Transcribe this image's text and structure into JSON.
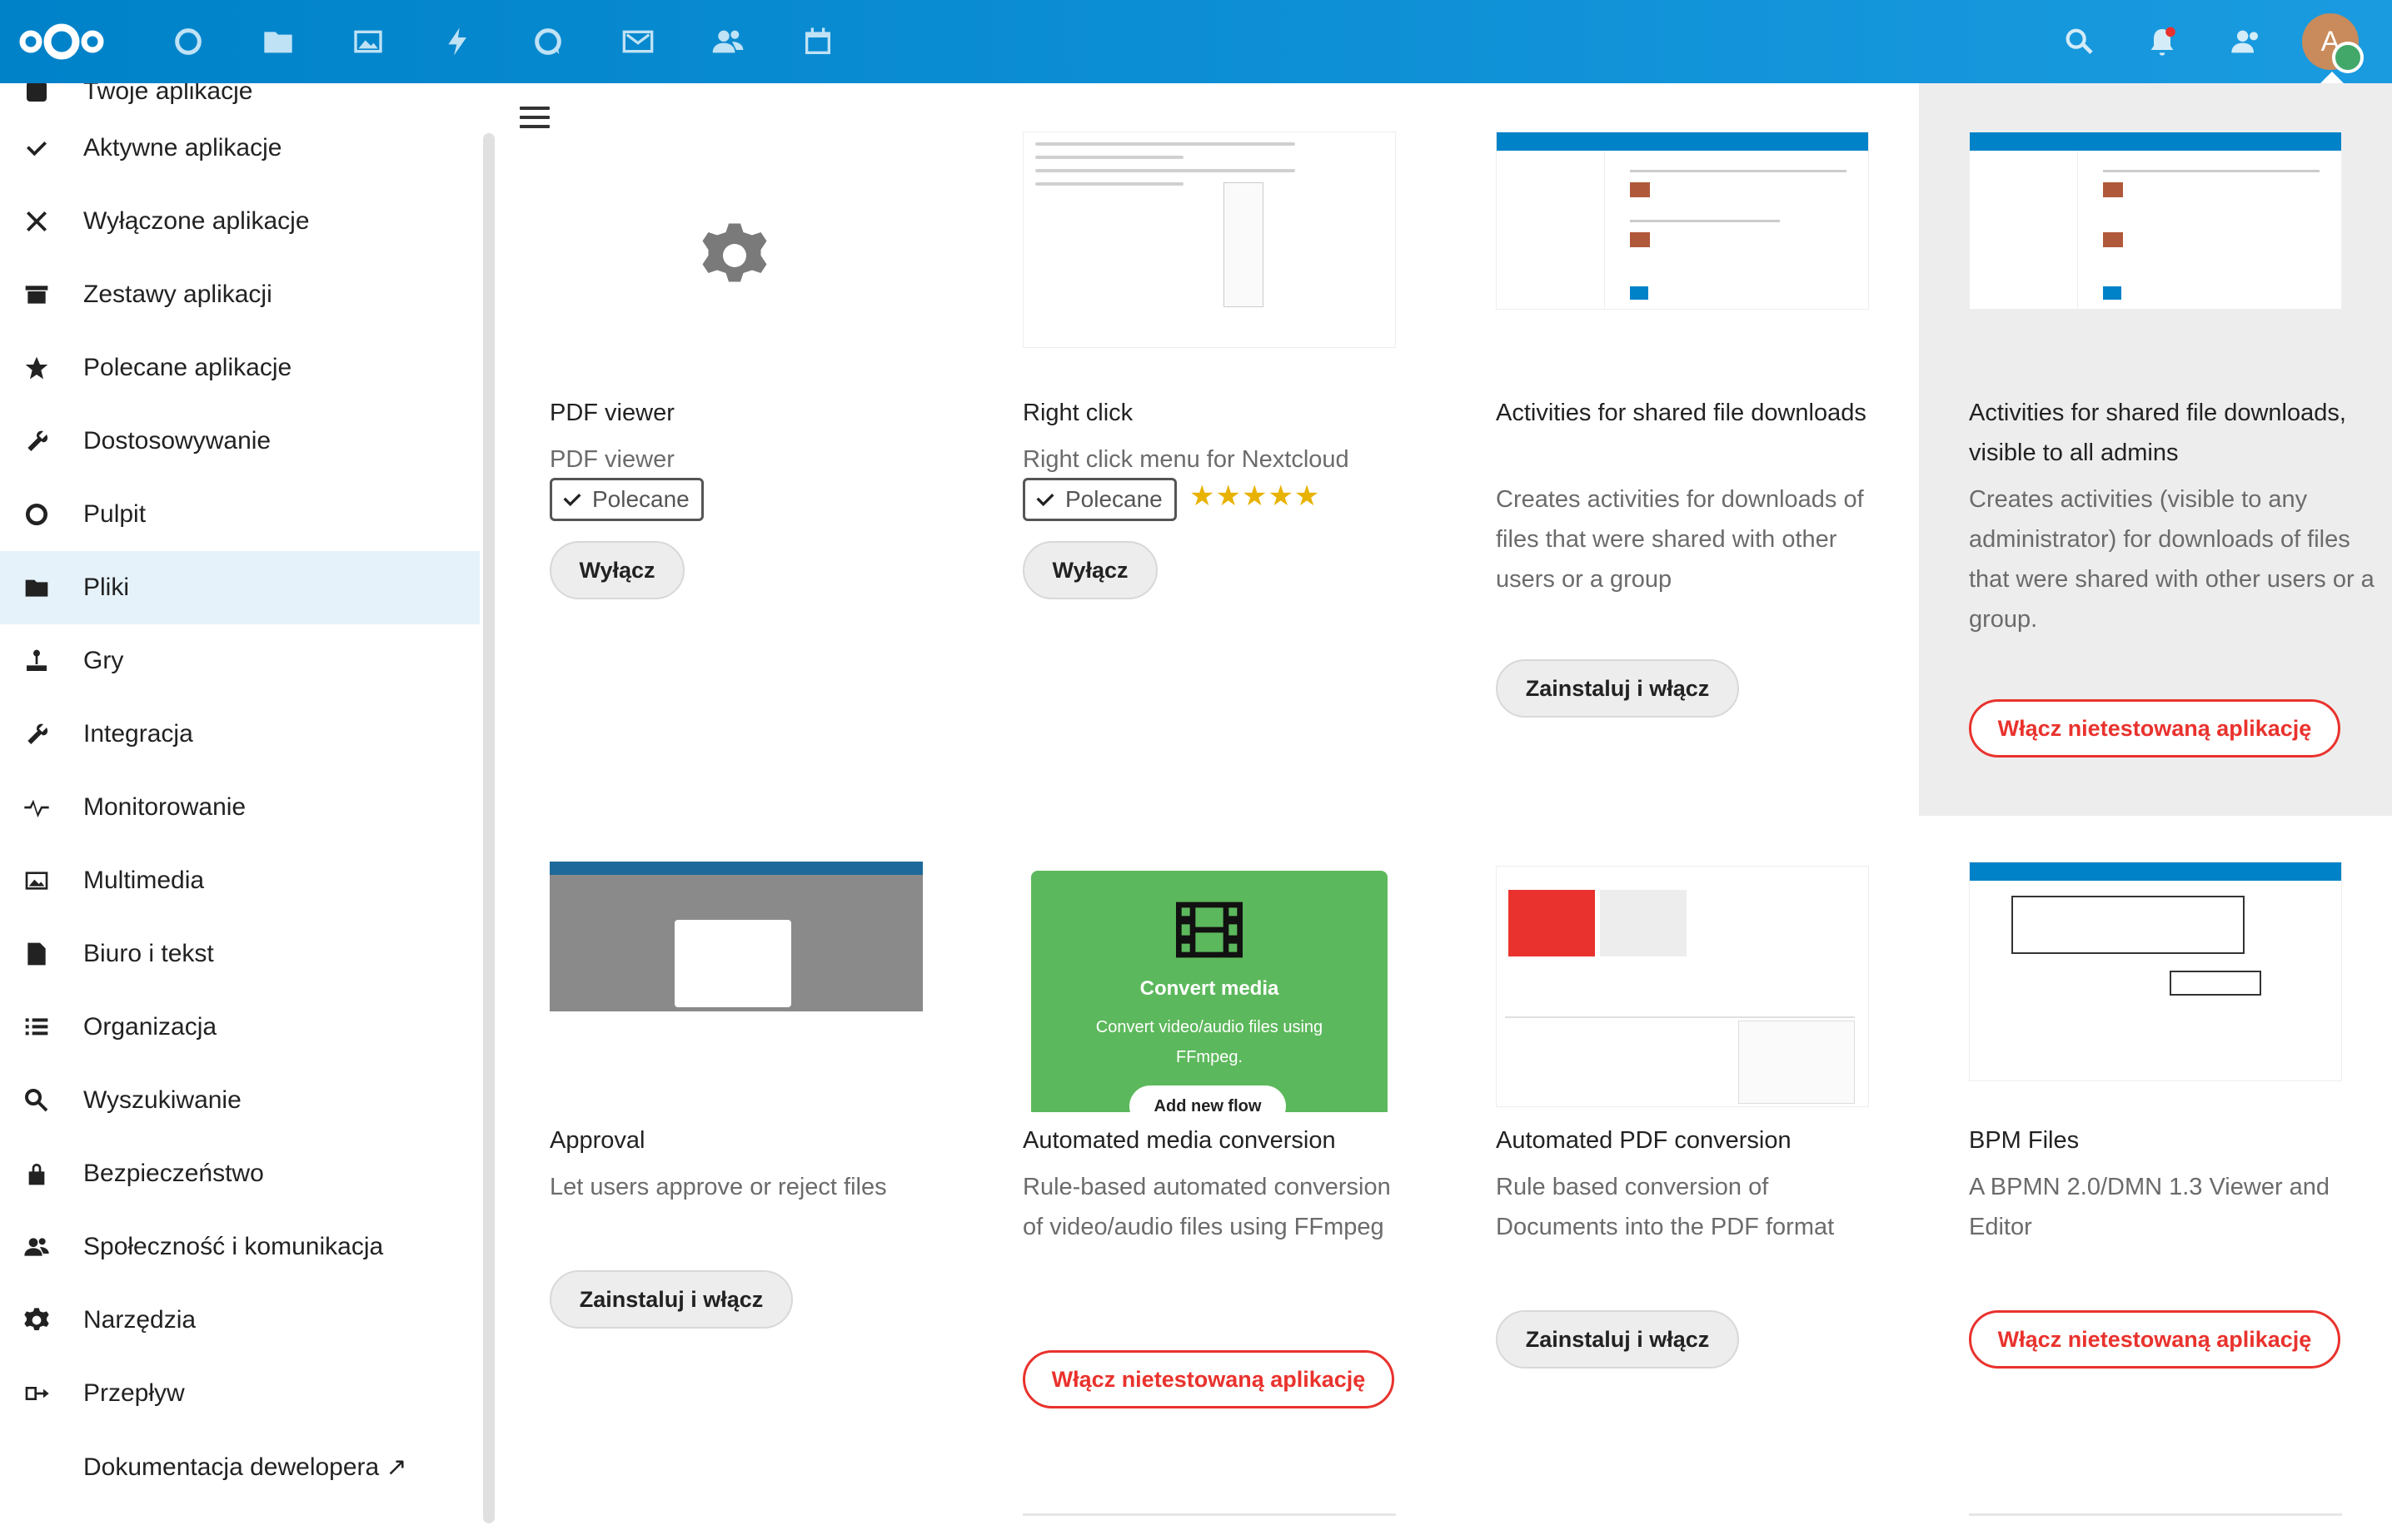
{
  "topbar": {
    "icons": [
      "dashboard-icon",
      "files-icon",
      "photos-icon",
      "activity-icon",
      "talk-icon",
      "mail-icon",
      "contacts-icon",
      "calendar-icon"
    ],
    "right_icons": [
      "search-icon",
      "notifications-icon",
      "contacts-menu-icon"
    ],
    "avatar_letter": "A",
    "colors": {
      "brand": "#0082c9",
      "accent_red": "#e9322d",
      "status_online": "#41a86a"
    }
  },
  "sidebar": {
    "partial_top_label": "Twoje aplikacje",
    "items": [
      {
        "label": "Aktywne aplikacje",
        "icon": "checkmark-icon"
      },
      {
        "label": "Wyłączone aplikacje",
        "icon": "close-icon"
      },
      {
        "label": "Zestawy aplikacji",
        "icon": "archive-icon"
      },
      {
        "label": "Polecane aplikacje",
        "icon": "star-icon"
      },
      {
        "label": "Dostosowywanie",
        "icon": "wrench-icon"
      },
      {
        "label": "Pulpit",
        "icon": "circle-icon"
      },
      {
        "label": "Pliki",
        "icon": "folder-icon",
        "active": true
      },
      {
        "label": "Gry",
        "icon": "joystick-icon"
      },
      {
        "label": "Integracja",
        "icon": "wrench-icon"
      },
      {
        "label": "Monitorowanie",
        "icon": "pulse-icon"
      },
      {
        "label": "Multimedia",
        "icon": "image-icon"
      },
      {
        "label": "Biuro i tekst",
        "icon": "document-icon"
      },
      {
        "label": "Organizacja",
        "icon": "list-icon"
      },
      {
        "label": "Wyszukiwanie",
        "icon": "search-icon"
      },
      {
        "label": "Bezpieczeństwo",
        "icon": "lock-icon"
      },
      {
        "label": "Społeczność i komunikacja",
        "icon": "people-icon"
      },
      {
        "label": "Narzędzia",
        "icon": "gear-icon"
      },
      {
        "label": "Przepływ",
        "icon": "flow-icon"
      },
      {
        "label": "Dokumentacja dewelopera ↗",
        "icon": ""
      }
    ]
  },
  "apps": [
    {
      "title": "PDF viewer",
      "desc": "PDF viewer",
      "badge": "Polecane",
      "button": "Wyłącz"
    },
    {
      "title": "Right click",
      "desc": "Right click menu for Nextcloud",
      "badge": "Polecane",
      "rating": "★★★★★",
      "button": "Wyłącz"
    },
    {
      "title": "Activities for shared file downloads",
      "desc": "Creates activities for downloads of files that were shared with other users or a group",
      "button": "Zainstaluj i włącz"
    },
    {
      "title": "Activities for shared file downloads, visible to all admins",
      "desc": "Creates activities (visible to any administrator) for downloads of files that were shared with other users or a group.",
      "button": "Włącz nietestowaną aplikację"
    },
    {
      "title": "Approval",
      "desc": "Let users approve or reject files",
      "button": "Zainstaluj i włącz"
    },
    {
      "title": "Automated media conversion",
      "desc": "Rule-based automated conversion of video/audio files using FFmpeg",
      "button": "Włącz nietestowaną aplikację",
      "preview": {
        "heading": "Convert media",
        "text": "Convert video/audio files using FFmpeg.",
        "cta": "Add new flow"
      }
    },
    {
      "title": "Automated PDF conversion",
      "desc": "Rule based conversion of Documents into the PDF format",
      "button": "Zainstaluj i włącz"
    },
    {
      "title": "BPM Files",
      "desc": "A BPMN 2.0/DMN 1.3 Viewer and Editor",
      "button": "Włącz nietestowaną aplikację"
    }
  ]
}
